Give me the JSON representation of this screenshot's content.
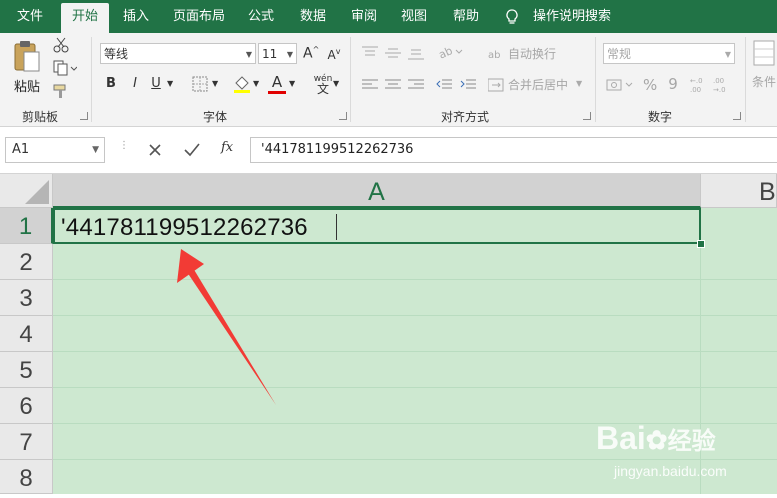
{
  "tabs": [
    {
      "label": "文件",
      "active": false
    },
    {
      "label": "开始",
      "active": true
    },
    {
      "label": "插入",
      "active": false
    },
    {
      "label": "页面布局",
      "active": false
    },
    {
      "label": "公式",
      "active": false
    },
    {
      "label": "数据",
      "active": false
    },
    {
      "label": "审阅",
      "active": false
    },
    {
      "label": "视图",
      "active": false
    },
    {
      "label": "帮助",
      "active": false
    }
  ],
  "tell_me": "操作说明搜索",
  "ribbon": {
    "clipboard": {
      "paste": "粘贴",
      "label": "剪贴板"
    },
    "font": {
      "name": "等线",
      "size": "11",
      "grow": "A",
      "shrink": "A",
      "bold": "B",
      "italic": "I",
      "underline": "U",
      "font_color_letter": "A",
      "phonetic": "wén",
      "label": "字体"
    },
    "alignment": {
      "wrap": "自动换行",
      "merge": "合并后居中",
      "label": "对齐方式"
    },
    "number": {
      "format": "常规",
      "percent": "%",
      "comma": "9",
      "label": "数字"
    },
    "styles": {
      "conditional": "条件"
    }
  },
  "formula_bar": {
    "name_box": "A1",
    "fx": "fx",
    "content": "'441781199512262736"
  },
  "grid": {
    "columns": [
      "A",
      "B"
    ],
    "rows": [
      "1",
      "2",
      "3",
      "4",
      "5",
      "6",
      "7",
      "8"
    ],
    "active_cell": "A1",
    "cell_a1": "'441781199512262736"
  },
  "colors": {
    "accent": "#217346",
    "selection_fill": "#cde8d0",
    "arrow": "#f23b35"
  },
  "watermark": {
    "brand": "Bai",
    "brand2": "经验",
    "url": "jingyan.baidu.com"
  }
}
